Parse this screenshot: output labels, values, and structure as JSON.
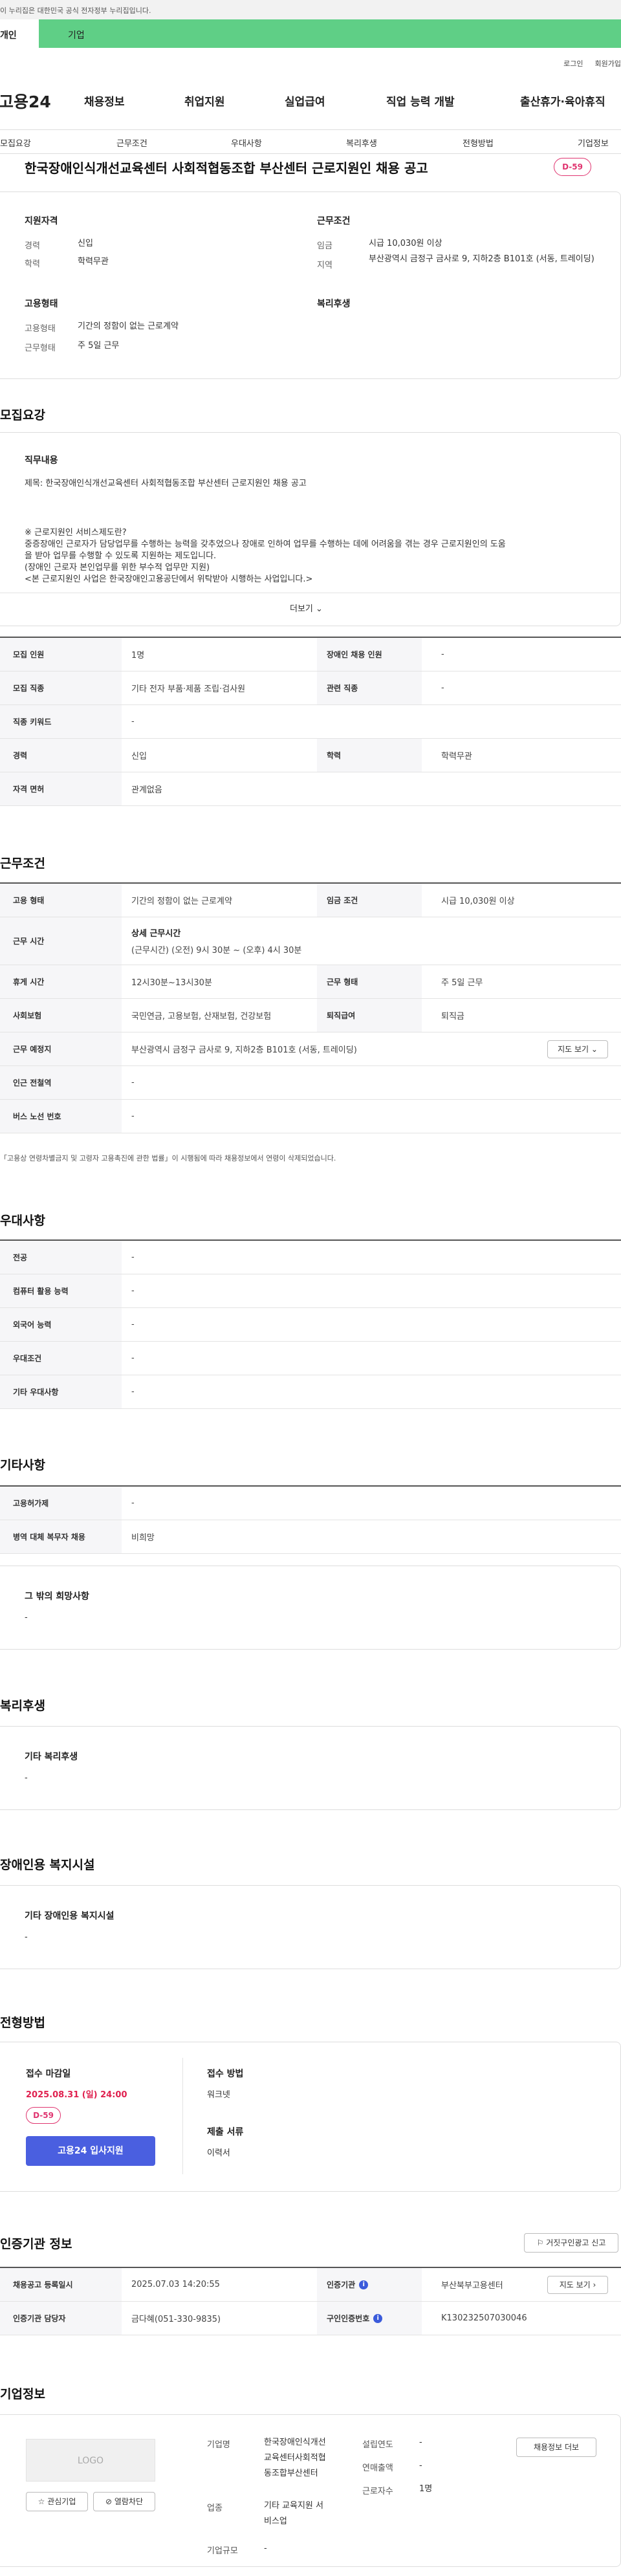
{
  "gov_banner": "이 누리집은 대한민국 공식 전자정부 누리집입니다.",
  "member_tabs": {
    "person": "개인",
    "company": "기업"
  },
  "util_links": [
    "로그인",
    "회원가입"
  ],
  "logo": "고용24",
  "gnb": [
    "채용정보",
    "취업지원",
    "실업급여",
    "직업 능력 개발",
    "출산휴가·육아휴직"
  ],
  "subnav": [
    "모집요강",
    "근무조건",
    "우대사항",
    "복리후생",
    "전형방법",
    "기업정보"
  ],
  "job_title": "한국장애인식개선교육센터 사회적협동조합 부산센터 근로지원인 채용 공고",
  "dday": "D-59",
  "summary": {
    "qual_head": "지원자격",
    "career_key": "경력",
    "career_val": "신입",
    "edu_key": "학력",
    "edu_val": "학력무관",
    "work_head": "근무조건",
    "wage_key": "임금",
    "wage_val": "시급 10,030원 이상",
    "region_key": "지역",
    "region_val": "부산광역시 금정구 금사로 9, 지하2층 B101호 (서동, 트레이딩)",
    "emp_head": "고용형태",
    "emptype_key": "고용형태",
    "emptype_val": "기간의 정함이 없는 근로계약",
    "worktype_key": "근무형태",
    "worktype_val": "주 5일 근무",
    "welfare_head": "복리후생"
  },
  "recruit": {
    "section": "모집요강",
    "job_desc_head": "직무내용",
    "job_desc_lines": [
      "제목:  한국장애인식개선교육센터 사회적협동조합 부산센터 근로지원인 채용 공고",
      "",
      "",
      "※ 근로지원인 서비스제도란?",
      "중증장애인 근로자가 담당업무를 수행하는 능력을 갖추었으나 장애로 인하여 업무를 수행하는 데에 어려움을 겪는 경우 근로지원인의 도움",
      "을 받아 업무를 수행할 수 있도록 지원하는 제도입니다.",
      "(장애인 근로자 본인업무를 위한 부수적 업무만 지원)",
      "<본 근로지원인 사업은 한국장애인고용공단에서 위탁받아 시행하는 사업입니다.>"
    ],
    "more": "더보기 ⌄",
    "rows": [
      {
        "k": "모집 인원",
        "v": "1명",
        "k2": "장애인 채용 인원",
        "v2": "-"
      },
      {
        "k": "모집 직종",
        "v": "기타 전자 부품·제품 조립·검사원",
        "k2": "관련 직종",
        "v2": "-"
      },
      {
        "k": "직종 키워드",
        "v": "-"
      },
      {
        "k": "경력",
        "v": "신입",
        "k2": "학력",
        "v2": "학력무관"
      },
      {
        "k": "자격 면허",
        "v": "관계없음"
      }
    ]
  },
  "work": {
    "section": "근무조건",
    "emp_type_k": "고용 형태",
    "emp_type_v": "기간의 정함이 없는 근로계약",
    "wage_k": "임금 조건",
    "wage_v": "시급 10,030원 이상",
    "hours_k": "근무 시간",
    "hours_head": "상세 근무시간",
    "hours_v": "(근무시간) (오전) 9시 30분 ~ (오후) 4시 30분",
    "break_k": "휴게 시간",
    "break_v": "12시30분~13시30분",
    "worktype_k": "근무 형태",
    "worktype_v": "주 5일 근무",
    "insurance_k": "사회보험",
    "insurance_v": "국민연금, 고용보험, 산재보험, 건강보험",
    "retire_k": "퇴직급여",
    "retire_v": "퇴직금",
    "place_k": "근무 예정지",
    "place_v": "부산광역시 금정구 금사로 9, 지하2층 B101호 (서동, 트레이딩)",
    "map_btn": "지도 보기 ⌄",
    "subway_k": "인근 전철역",
    "subway_v": "-",
    "bus_k": "버스 노선 번호",
    "bus_v": "-",
    "note": "「고용상 연령차별금지 및 고령자 고용촉진에 관한 법률」이 시행됨에 따라 채용정보에서 연령이 삭제되었습니다."
  },
  "pref": {
    "section": "우대사항",
    "rows": [
      {
        "k": "전공",
        "v": "-"
      },
      {
        "k": "컴퓨터 활용 능력",
        "v": "-"
      },
      {
        "k": "외국어 능력",
        "v": "-"
      },
      {
        "k": "우대조건",
        "v": "-"
      },
      {
        "k": "기타 우대사항",
        "v": "-"
      }
    ]
  },
  "etc": {
    "section": "기타사항",
    "rows": [
      {
        "k": "고용허가제",
        "v": "-"
      },
      {
        "k": "병역 대체 복무자 채용",
        "v": "비희망"
      }
    ],
    "other_head": "그 밖의 희망사항",
    "other_val": "-"
  },
  "welfare": {
    "section": "복리후생",
    "head": "기타 복리후생",
    "val": "-"
  },
  "disabled": {
    "section": "장애인용 복지시설",
    "head": "기타 장애인용 복지시설",
    "val": "-"
  },
  "process": {
    "section": "전형방법",
    "deadline_head": "접수 마감일",
    "deadline_val": "2025.08.31 (일) 24:00",
    "dday": "D-59",
    "apply_btn": "고용24 입사지원",
    "method_head": "접수 방법",
    "method_val": "워크넷",
    "docs_head": "제출 서류",
    "docs_val": "이력서"
  },
  "cert": {
    "section": "인증기관 정보",
    "report_btn": "거짓구인광고 신고",
    "reg_k": "채용공고 등록일시",
    "reg_v": "2025.07.03 14:20:55",
    "org_k": "인증기관",
    "org_v": "부산북부고용센터",
    "map_btn": "지도 보기 ›",
    "mgr_k": "인증기관 담당자",
    "mgr_v": "금다혜(051-330-9835)",
    "no_k": "구인인증번호",
    "no_v": "K130232507030046"
  },
  "company": {
    "section": "기업정보",
    "logo": "LOGO",
    "fav_btn": "☆ 관심기업",
    "block_btn": "⊘ 열람차단",
    "name_k": "기업명",
    "name_lines": [
      "한국장애인식개선",
      "교육센터사회적협",
      "동조합부산센터"
    ],
    "industry_k": "업종",
    "industry_lines": [
      "기타 교육지원 서",
      "비스업"
    ],
    "size_k": "기업규모",
    "size_v": "-",
    "year_k": "설립연도",
    "year_v": "-",
    "sales_k": "연매출액",
    "sales_v": "-",
    "emp_k": "근로자수",
    "emp_v": "1명",
    "more_btn": "채용정보 더보"
  }
}
